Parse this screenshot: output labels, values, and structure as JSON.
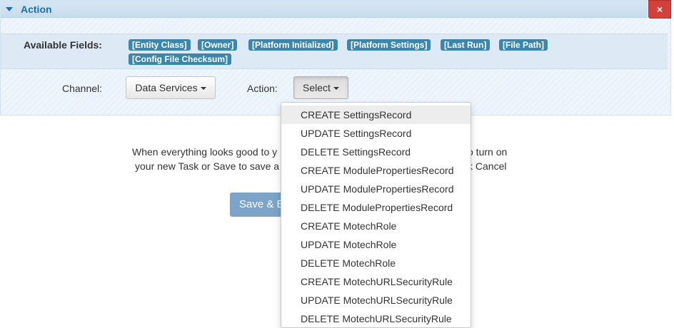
{
  "panel": {
    "title": "Action",
    "close_label": "×"
  },
  "fields": {
    "label": "Available Fields:",
    "tags": [
      "[Entity Class]",
      "[Owner]",
      "[Platform Initialized]",
      "[Platform Settings]",
      "[Last Run]",
      "[File Path]",
      "[Config File Checksum]"
    ]
  },
  "channel": {
    "label": "Channel:",
    "value": "Data Services"
  },
  "action": {
    "label": "Action:",
    "value": "Select"
  },
  "message": {
    "line1_left": "When everything looks good to y",
    "line1_right": "o turn on",
    "line2_left": "your new Task or Save to save a",
    "line2_right": "k Cancel"
  },
  "save_button": {
    "label": "Save & E"
  },
  "dropdown": {
    "items": [
      "CREATE SettingsRecord",
      "UPDATE SettingsRecord",
      "DELETE SettingsRecord",
      "CREATE ModulePropertiesRecord",
      "UPDATE ModulePropertiesRecord",
      "DELETE ModulePropertiesRecord",
      "CREATE MotechRole",
      "UPDATE MotechRole",
      "DELETE MotechRole",
      "CREATE MotechURLSecurityRule",
      "UPDATE MotechURLSecurityRule",
      "DELETE MotechURLSecurityRule"
    ]
  }
}
